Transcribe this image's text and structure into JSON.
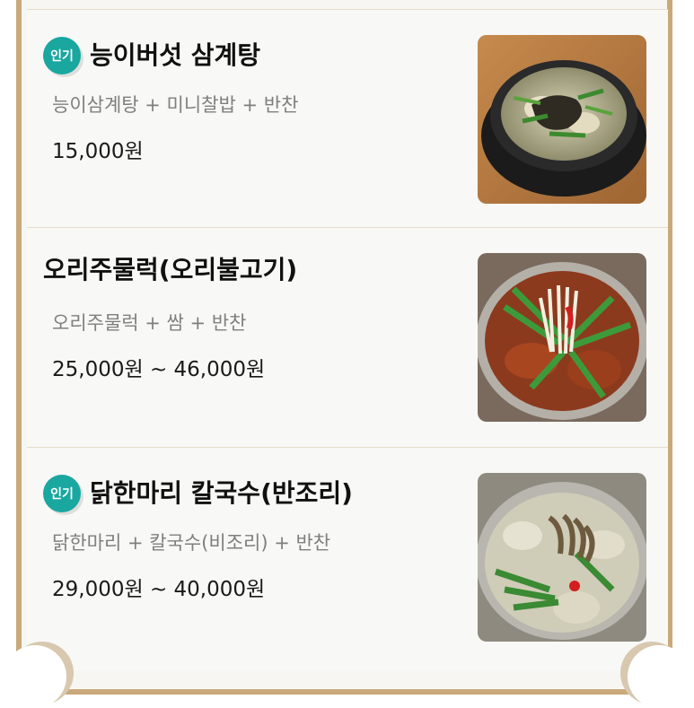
{
  "menu": {
    "items": [
      {
        "badge": "인기",
        "title": "능이버섯 삼계탕",
        "desc": "능이삼계탕 + 미니찰밥 + 반찬",
        "price": "15,000원"
      },
      {
        "badge": "",
        "title": "오리주물럭(오리불고기)",
        "desc": "오리주물럭 + 쌈 + 반찬",
        "price": "25,000원 ~ 46,000원"
      },
      {
        "badge": "인기",
        "title": "닭한마리 칼국수(반조리)",
        "desc": "닭한마리 + 칼국수(비조리) + 반찬",
        "price": "29,000원 ~ 40,000원"
      }
    ]
  },
  "colors": {
    "badge": "#19a7a0",
    "frame": "#c9a97a"
  }
}
